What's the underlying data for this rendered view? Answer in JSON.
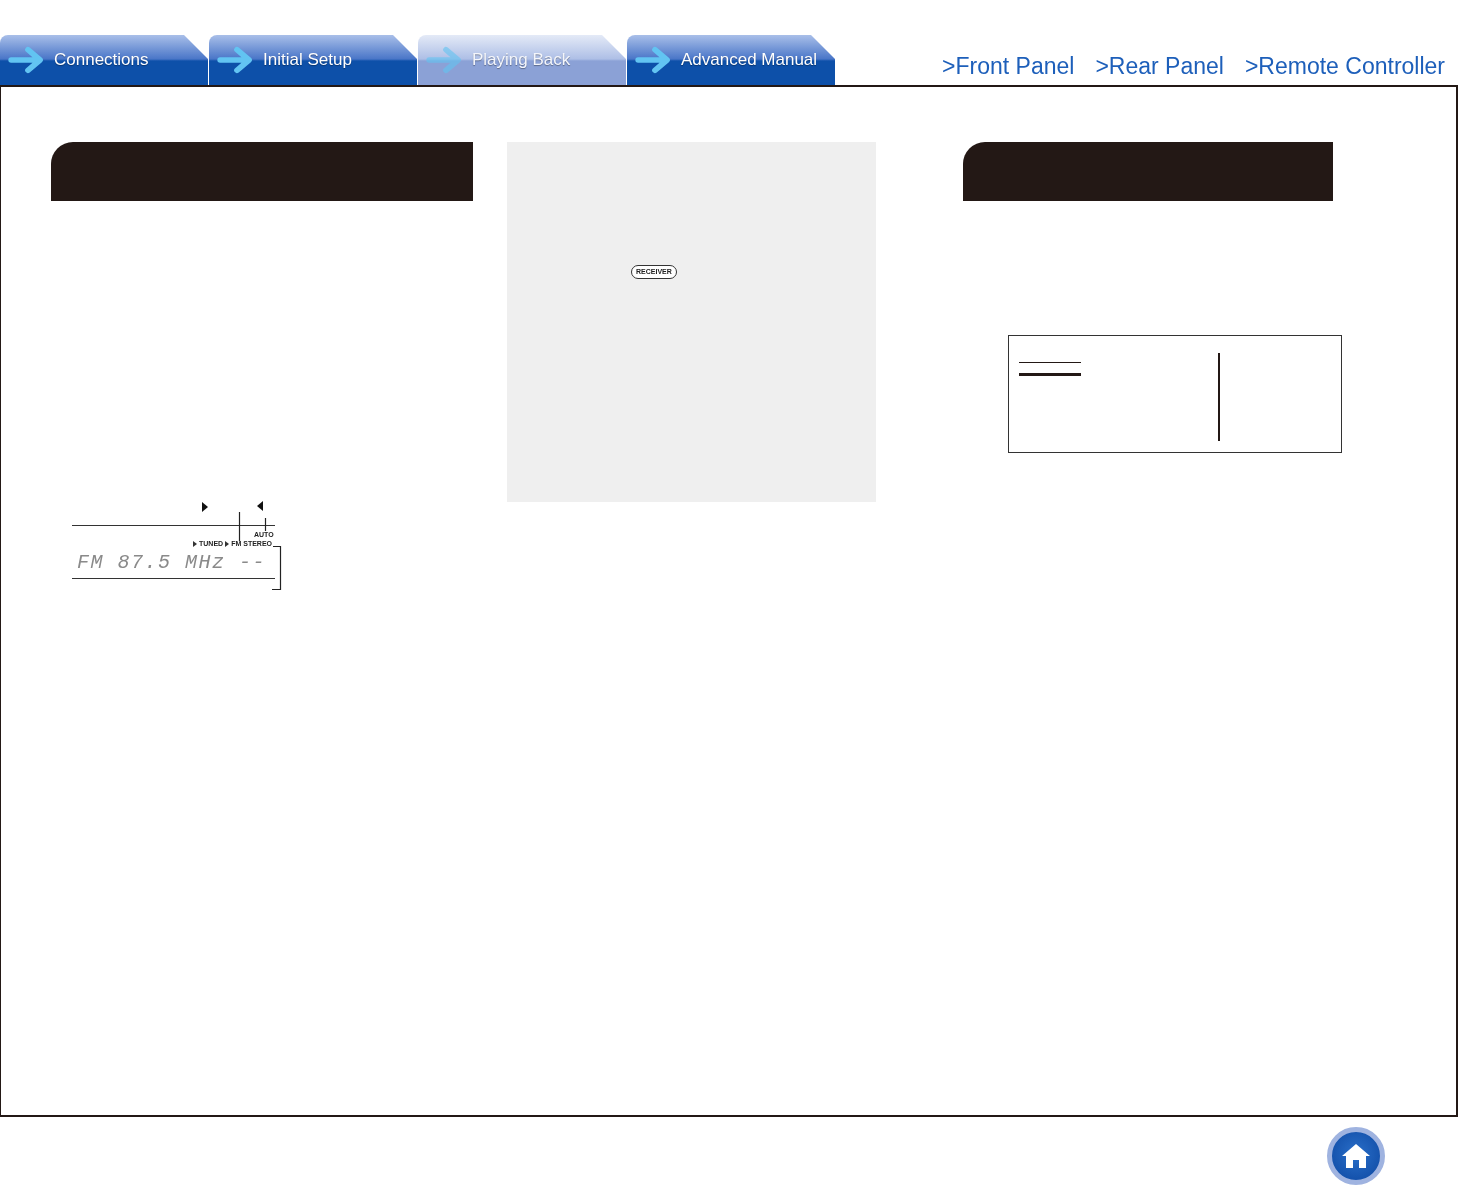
{
  "tabs": [
    {
      "label": "Connections",
      "selected": false
    },
    {
      "label": "Initial Setup",
      "selected": false
    },
    {
      "label": "Playing Back",
      "selected": true
    },
    {
      "label": "Advanced Manual",
      "selected": false
    }
  ],
  "nav_links": [
    ">Front Panel",
    ">Rear Panel",
    ">Remote Controller"
  ],
  "display_diagram": {
    "readout": "FM 87.5 MHz --",
    "indicators": {
      "upper": [
        "AUTO"
      ],
      "lower": [
        "TUNED",
        "FM STEREO"
      ]
    }
  },
  "receiver_button": {
    "label": "RECEIVER"
  }
}
